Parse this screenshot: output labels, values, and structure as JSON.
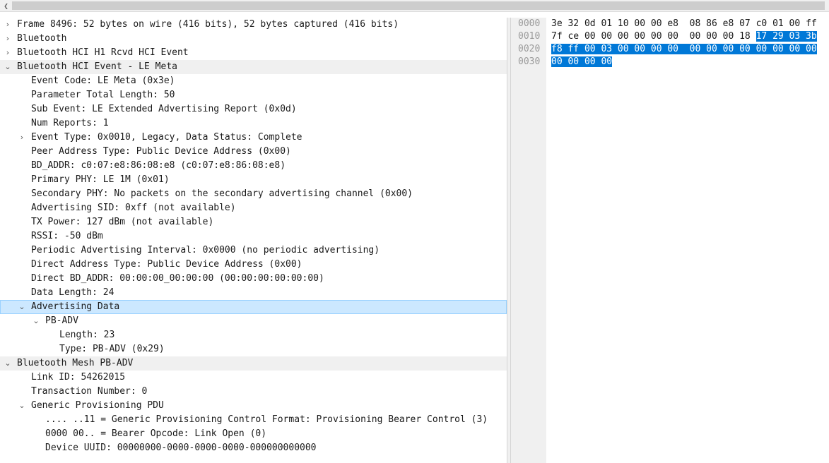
{
  "scrollbar": {
    "left_arrow_icon": "chevron-left-icon"
  },
  "tree": [
    {
      "text": "Frame 8496: 52 bytes on wire (416 bits), 52 bytes captured (416 bits)",
      "chev": "›",
      "indent": 0,
      "hdr": false
    },
    {
      "text": "Bluetooth",
      "chev": "›",
      "indent": 0,
      "hdr": false
    },
    {
      "text": "Bluetooth HCI H1 Rcvd HCI Event",
      "chev": "›",
      "indent": 0,
      "hdr": false
    },
    {
      "text": "Bluetooth HCI Event - LE Meta",
      "chev": "⌄",
      "indent": 0,
      "hdr": true
    },
    {
      "text": "Event Code: LE Meta (0x3e)",
      "chev": "",
      "indent": 1
    },
    {
      "text": "Parameter Total Length: 50",
      "chev": "",
      "indent": 1
    },
    {
      "text": "Sub Event: LE Extended Advertising Report (0x0d)",
      "chev": "",
      "indent": 1
    },
    {
      "text": "Num Reports: 1",
      "chev": "",
      "indent": 1
    },
    {
      "text": "Event Type: 0x0010, Legacy, Data Status: Complete",
      "chev": "›",
      "indent": 1
    },
    {
      "text": "Peer Address Type: Public Device Address (0x00)",
      "chev": "",
      "indent": 1
    },
    {
      "text": "BD_ADDR: c0:07:e8:86:08:e8 (c0:07:e8:86:08:e8)",
      "chev": "",
      "indent": 1
    },
    {
      "text": "Primary PHY: LE 1M (0x01)",
      "chev": "",
      "indent": 1
    },
    {
      "text": "Secondary PHY: No packets on the secondary advertising channel (0x00)",
      "chev": "",
      "indent": 1
    },
    {
      "text": "Advertising SID: 0xff (not available)",
      "chev": "",
      "indent": 1
    },
    {
      "text": "TX Power: 127 dBm (not available)",
      "chev": "",
      "indent": 1
    },
    {
      "text": "RSSI: -50 dBm",
      "chev": "",
      "indent": 1
    },
    {
      "text": "Periodic Advertising Interval: 0x0000 (no periodic advertising)",
      "chev": "",
      "indent": 1
    },
    {
      "text": "Direct Address Type: Public Device Address (0x00)",
      "chev": "",
      "indent": 1
    },
    {
      "text": "Direct BD_ADDR: 00:00:00_00:00:00 (00:00:00:00:00:00)",
      "chev": "",
      "indent": 1
    },
    {
      "text": "Data Length: 24",
      "chev": "",
      "indent": 1
    },
    {
      "text": "Advertising Data",
      "chev": "⌄",
      "indent": 1,
      "selected": true
    },
    {
      "text": "PB-ADV",
      "chev": "⌄",
      "indent": 2
    },
    {
      "text": "Length: 23",
      "chev": "",
      "indent": 3
    },
    {
      "text": "Type: PB-ADV (0x29)",
      "chev": "",
      "indent": 3
    },
    {
      "text": "Bluetooth Mesh PB-ADV",
      "chev": "⌄",
      "indent": 0,
      "hdr": true
    },
    {
      "text": "Link ID: 54262015",
      "chev": "",
      "indent": 1
    },
    {
      "text": "Transaction Number: 0",
      "chev": "",
      "indent": 1
    },
    {
      "text": "Generic Provisioning PDU",
      "chev": "⌄",
      "indent": 1
    },
    {
      "text": ".... ..11 = Generic Provisioning Control Format: Provisioning Bearer Control (3)",
      "chev": "",
      "indent": 2
    },
    {
      "text": "0000 00.. = Bearer Opcode: Link Open (0)",
      "chev": "",
      "indent": 2
    },
    {
      "text": "Device UUID: 00000000-0000-0000-0000-000000000000",
      "chev": "",
      "indent": 2
    }
  ],
  "hex": {
    "offsets": [
      "0000",
      "0010",
      "0020",
      "0030"
    ],
    "lines": [
      {
        "plain": "3e 32 0d 01 10 00 00 e8  08 86 e8 07 c0 01 00 ff",
        "hl": ""
      },
      {
        "plain": "7f ce 00 00 00 00 00 00  00 00 00 18 ",
        "hl": "17 29 03 3b"
      },
      {
        "plain": "",
        "hl": "f8 ff 00 03 00 00 00 00  00 00 00 00 00 00 00 00"
      },
      {
        "plain": "",
        "hl": "00 00 00 00"
      }
    ],
    "highlight_color": "#0078d7"
  }
}
